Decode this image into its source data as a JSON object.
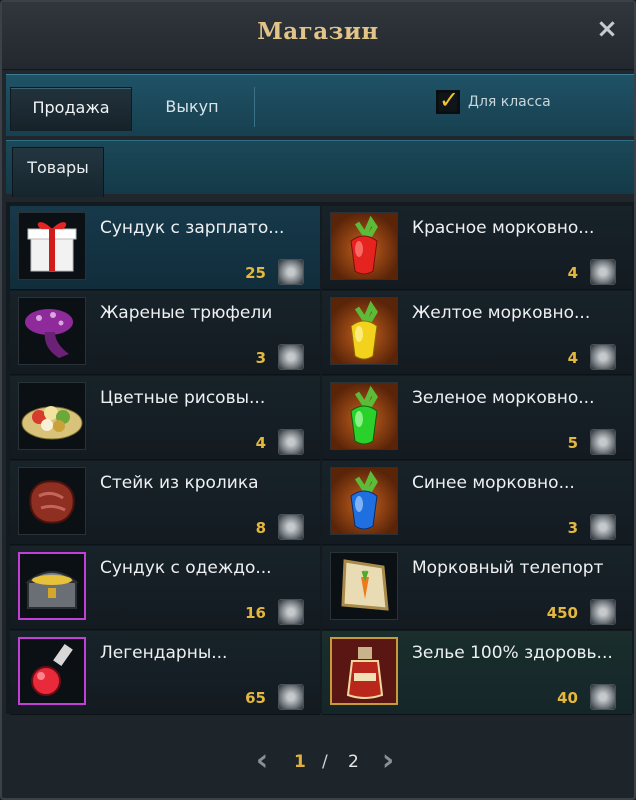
{
  "window": {
    "title": "Магазин",
    "close_symbol": "×"
  },
  "tabs": [
    {
      "label": "Продажа",
      "active": true
    },
    {
      "label": "Выкуп",
      "active": false
    }
  ],
  "class_filter": {
    "label": "Для класса",
    "checked": true
  },
  "category_tabs": [
    {
      "label": "Товары",
      "active": true
    }
  ],
  "currency_icon": "silver-coin-icon",
  "items": [
    {
      "name": "Сундук с зарплато...",
      "price": "25",
      "icon": "gift-box-icon"
    },
    {
      "name": "Красное морковно...",
      "price": "4",
      "icon": "red-carrot-potion-icon"
    },
    {
      "name": "Жареные трюфели",
      "price": "3",
      "icon": "truffle-mushroom-icon"
    },
    {
      "name": "Желтое морковно...",
      "price": "4",
      "icon": "yellow-carrot-potion-icon"
    },
    {
      "name": "Цветные рисовы...",
      "price": "4",
      "icon": "rice-cakes-plate-icon"
    },
    {
      "name": "Зеленое морковно...",
      "price": "5",
      "icon": "green-carrot-potion-icon"
    },
    {
      "name": "Стейк из кролика",
      "price": "8",
      "icon": "rabbit-steak-icon"
    },
    {
      "name": "Синее морковно...",
      "price": "3",
      "icon": "blue-carrot-potion-icon"
    },
    {
      "name": "Сундук с одеждо...",
      "price": "16",
      "icon": "treasure-chest-icon"
    },
    {
      "name": "Морковный телепорт",
      "price": "450",
      "icon": "carrot-teleport-scroll-icon"
    },
    {
      "name": "Легендарны...",
      "price": "65",
      "icon": "legendary-potion-bottle-icon"
    },
    {
      "name": "Зелье 100% здоровь...",
      "price": "40",
      "icon": "health-potion-icon"
    }
  ],
  "pagination": {
    "current": "1",
    "separator": "/",
    "total": "2"
  },
  "colors": {
    "title": "#e2c489",
    "price": "#e4b73f",
    "tab_bar": "#1f5266",
    "selected_row": "#16394a",
    "checkmark": "#f0c62c"
  }
}
